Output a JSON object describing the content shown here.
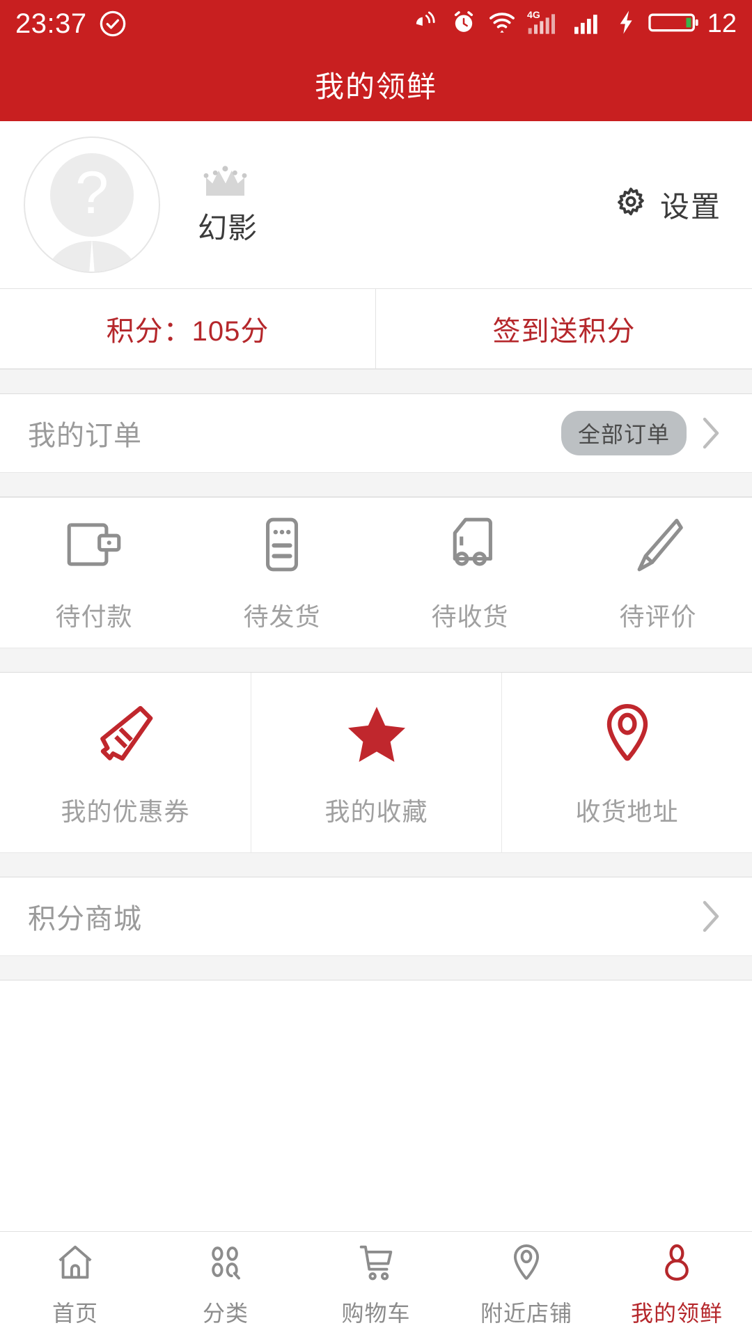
{
  "colors": {
    "brand_red": "#c81f20",
    "accent_red": "#b5272b",
    "gray_text": "#9a9a9a",
    "icon_gray": "#8c8c8c",
    "battery_green": "#39b54a"
  },
  "statusbar": {
    "time": "23:37",
    "battery_level": "12",
    "icons": [
      "check-circle-icon",
      "vibrate-icon",
      "alarm-clock-icon",
      "wifi-icon",
      "signal-4g-icon",
      "signal-bars-icon",
      "charging-bolt-icon",
      "battery-icon"
    ],
    "network_label": "4G"
  },
  "titlebar": {
    "title": "我的领鲜"
  },
  "profile": {
    "avatar_placeholder": "?",
    "crown_icon": "crown-icon",
    "username": "幻影",
    "settings_label": "设置",
    "settings_icon": "gear-icon"
  },
  "points": {
    "balance_label": "积分：105分",
    "signin_label": "签到送积分"
  },
  "orders": {
    "section_title": "我的订单",
    "all_orders_label": "全部订单",
    "chevron_icon": "chevron-right-icon",
    "statuses": [
      {
        "label": "待付款",
        "icon": "wallet-icon"
      },
      {
        "label": "待发货",
        "icon": "package-document-icon"
      },
      {
        "label": "待收货",
        "icon": "truck-icon"
      },
      {
        "label": "待评价",
        "icon": "pencil-icon"
      }
    ]
  },
  "services": [
    {
      "label": "我的优惠券",
      "icon": "coupon-icon"
    },
    {
      "label": "我的收藏",
      "icon": "star-icon"
    },
    {
      "label": "收货地址",
      "icon": "location-pin-icon"
    }
  ],
  "points_mall": {
    "label": "积分商城",
    "chevron_icon": "chevron-right-icon"
  },
  "bottom_nav": [
    {
      "label": "首页",
      "icon": "home-icon",
      "active": false
    },
    {
      "label": "分类",
      "icon": "categories-icon",
      "active": false
    },
    {
      "label": "购物车",
      "icon": "cart-icon",
      "active": false
    },
    {
      "label": "附近店铺",
      "icon": "location-pin-icon",
      "active": false
    },
    {
      "label": "我的领鲜",
      "icon": "person-icon",
      "active": true
    }
  ]
}
